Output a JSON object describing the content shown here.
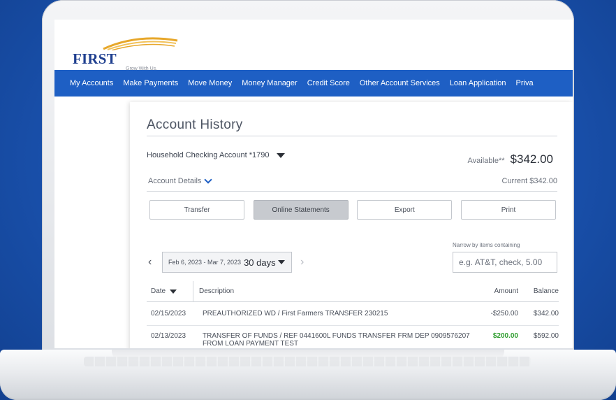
{
  "brand": {
    "name": "FIRST FARMERS.",
    "tagline": "Grow With Us.",
    "accent_color": "#1e5fc4"
  },
  "nav": {
    "items": [
      "My Accounts",
      "Make Payments",
      "Move Money",
      "Money Manager",
      "Credit Score",
      "Other Account Services",
      "Loan Application",
      "Priva"
    ]
  },
  "page": {
    "title": "Account History",
    "account": "Household Checking Account  *1790",
    "available_label": "Available**",
    "available_value": "$342.00",
    "details_label": "Account Details",
    "current": "Current  $342.00"
  },
  "actions": {
    "transfer": "Transfer",
    "online_statements": "Online Statements",
    "export": "Export",
    "print": "Print"
  },
  "filter": {
    "narrow_label": "Narrow by items containing",
    "narrow_placeholder": "e.g. AT&T, check, 5.00",
    "date_range": "Feb 6, 2023 - Mar 7, 2023",
    "days": "30 days"
  },
  "table": {
    "headers": {
      "date": "Date",
      "description": "Description",
      "amount": "Amount",
      "balance": "Balance"
    },
    "rows": [
      {
        "date": "02/15/2023",
        "description": "PREAUTHORIZED WD / First Farmers TRANSFER 230215",
        "amount": "-$250.00",
        "balance": "$342.00"
      },
      {
        "date": "02/13/2023",
        "description": "TRANSFER OF FUNDS / REF 0441600L FUNDS TRANSFER FRM DEP 0909576207 FROM LOAN PAYMENT TEST",
        "amount": "$200.00",
        "balance": "$592.00"
      }
    ]
  }
}
